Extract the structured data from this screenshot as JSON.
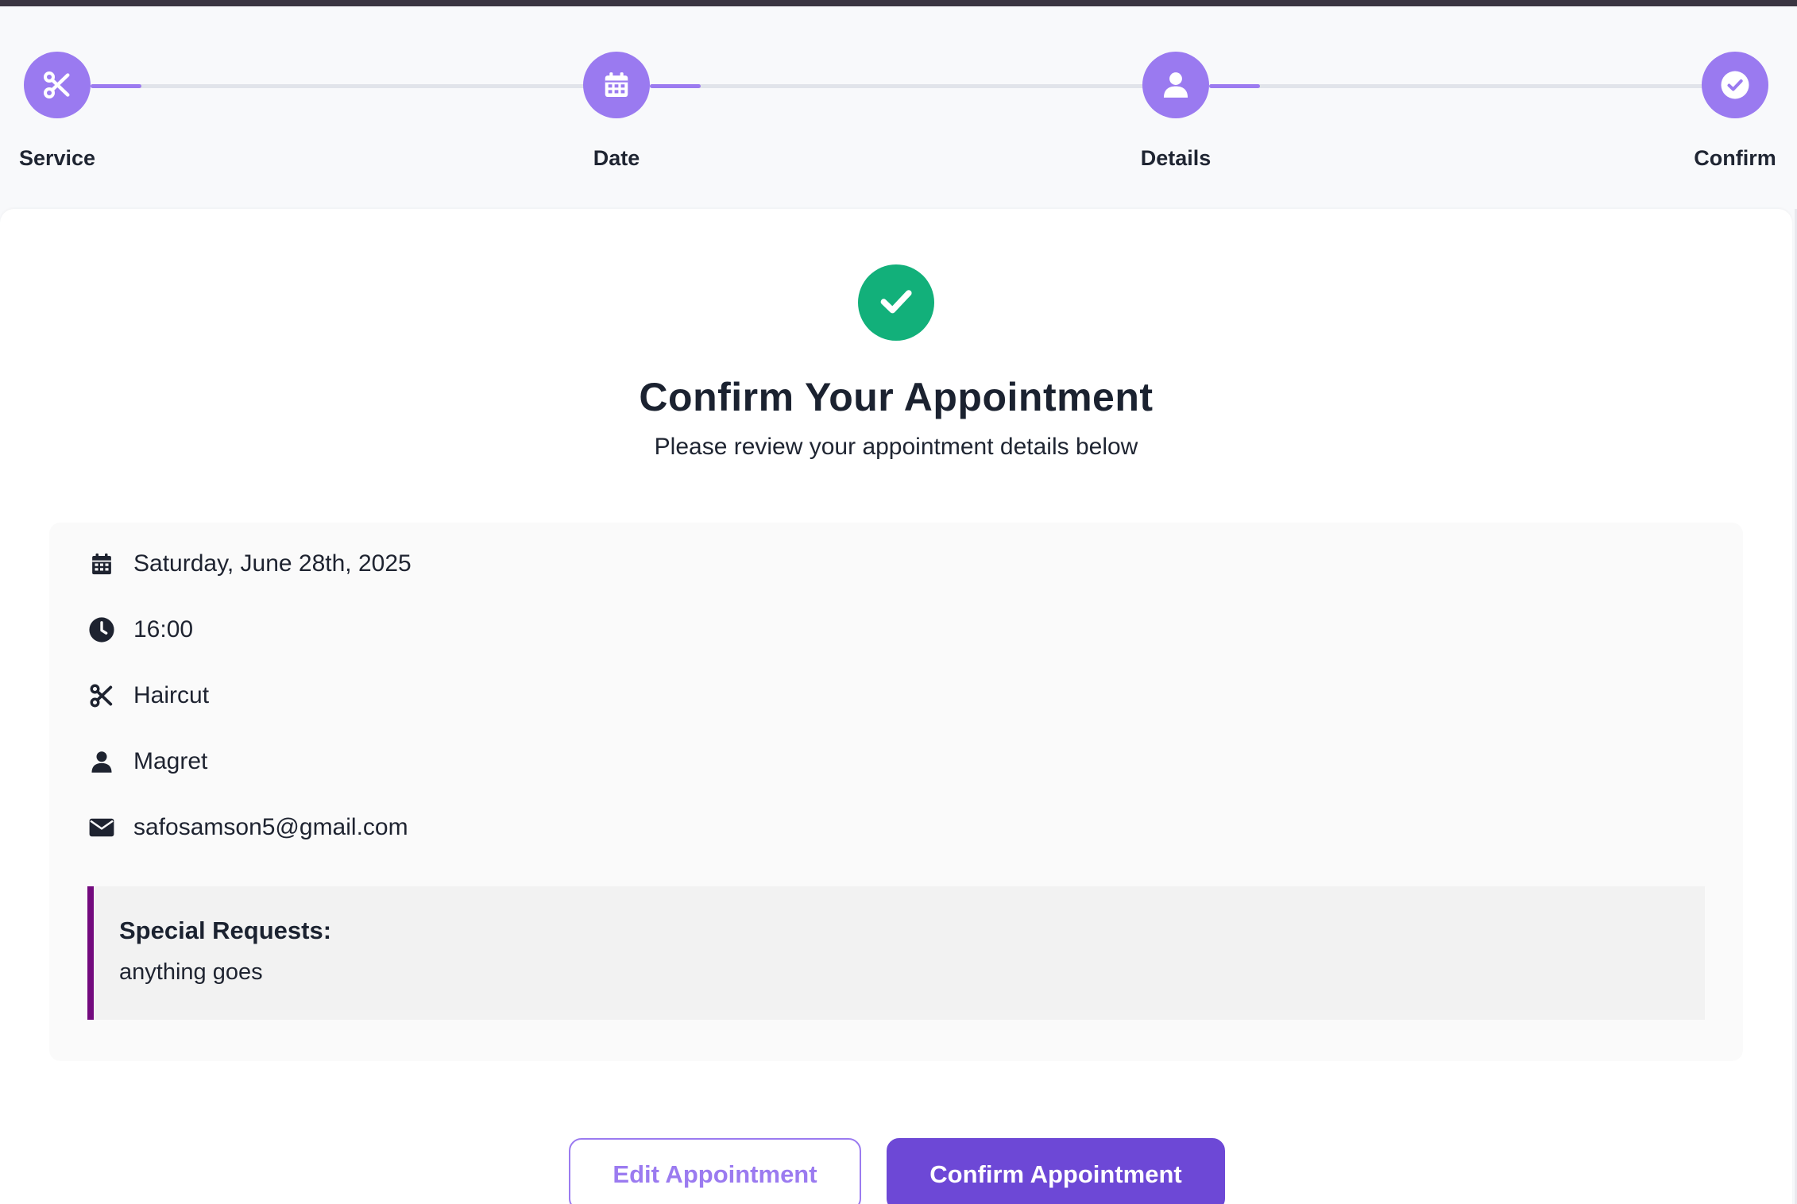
{
  "stepper": {
    "steps": [
      {
        "label": "Service",
        "icon": "scissors-icon"
      },
      {
        "label": "Date",
        "icon": "calendar-icon"
      },
      {
        "label": "Details",
        "icon": "user-icon"
      },
      {
        "label": "Confirm",
        "icon": "check-circle-icon"
      }
    ]
  },
  "confirmation": {
    "status_icon": "check-icon",
    "title": "Confirm Your Appointment",
    "subtitle": "Please review your appointment details below"
  },
  "details": {
    "date": "Saturday, June 28th, 2025",
    "time": "16:00",
    "service": "Haircut",
    "name": "Magret",
    "email": "safosamson5@gmail.com",
    "special_requests_label": "Special Requests:",
    "special_requests": "anything goes"
  },
  "actions": {
    "edit_label": "Edit Appointment",
    "confirm_label": "Confirm Appointment"
  },
  "colors": {
    "accent": "#9a7af0",
    "primary_button": "#6d48d6",
    "success": "#12b07a",
    "requests_border": "#730a7e"
  }
}
